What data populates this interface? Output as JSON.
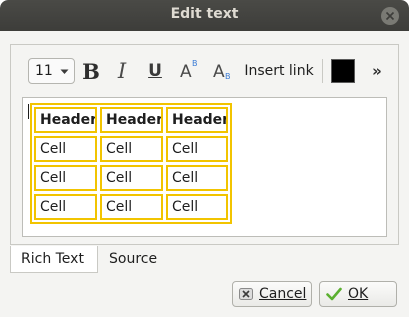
{
  "window": {
    "title": "Edit text"
  },
  "toolbar": {
    "font_size": "11",
    "bold_glyph": "B",
    "italic_glyph": "I",
    "underline_glyph": "U",
    "superscript_glyph": "A",
    "superscript_mark": "B",
    "subscript_glyph": "A",
    "subscript_mark": "B",
    "insert_link_label": "Insert link",
    "text_color": "#000000",
    "more_glyph": "»"
  },
  "table": {
    "headers": [
      "Header",
      "Header",
      "Header"
    ],
    "rows": [
      [
        "Cell",
        "Cell",
        "Cell"
      ],
      [
        "Cell",
        "Cell",
        "Cell"
      ],
      [
        "Cell",
        "Cell",
        "Cell"
      ]
    ],
    "border_color": "#f2c400"
  },
  "tabs": [
    {
      "label": "Rich Text",
      "active": true
    },
    {
      "label": "Source",
      "active": false
    }
  ],
  "buttons": {
    "cancel_label": "Cancel",
    "ok_label": "OK"
  }
}
